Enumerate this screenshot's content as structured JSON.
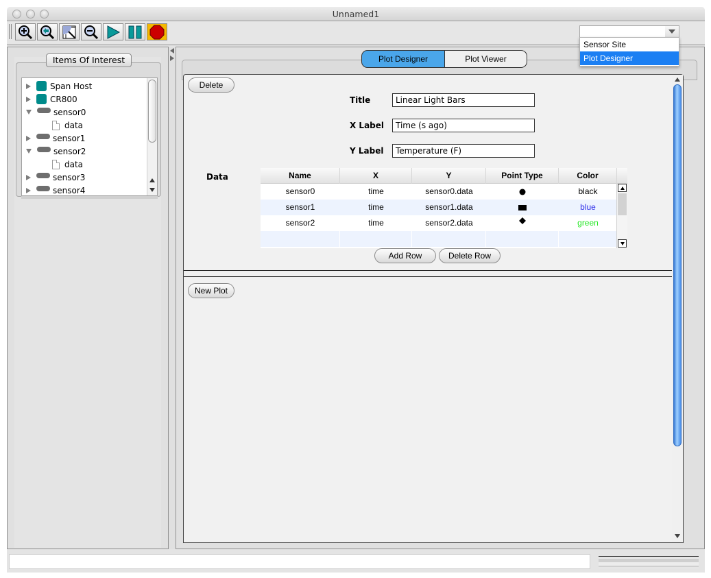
{
  "window": {
    "title": "Unnamed1"
  },
  "toolbar": {
    "buttons": [
      {
        "icon": "zoom-in-icon",
        "label": "Zoom In"
      },
      {
        "icon": "zoom-back-icon",
        "label": "Zoom Back"
      },
      {
        "icon": "zoom-fit-icon",
        "label": "Zoom To Fit"
      },
      {
        "icon": "zoom-out-icon",
        "label": "Zoom Out"
      },
      {
        "icon": "play-icon",
        "label": "Play"
      },
      {
        "icon": "pause-icon",
        "label": "Pause"
      },
      {
        "icon": "stop-icon",
        "label": "Stop",
        "active": true
      }
    ],
    "view_combo": {
      "value": "",
      "options": [
        "Sensor Site",
        "Plot Designer"
      ],
      "highlighted": "Plot Designer"
    }
  },
  "left_panel": {
    "group_title": "Items Of Interest",
    "tree": [
      {
        "label": "Span Host",
        "type": "host",
        "expanded": false,
        "depth": 0
      },
      {
        "label": "CR800",
        "type": "host",
        "expanded": false,
        "depth": 0
      },
      {
        "label": "sensor0",
        "type": "sensor",
        "expanded": true,
        "depth": 0
      },
      {
        "label": "data",
        "type": "data",
        "depth": 1
      },
      {
        "label": "sensor1",
        "type": "sensor",
        "expanded": false,
        "depth": 0
      },
      {
        "label": "sensor2",
        "type": "sensor",
        "expanded": true,
        "depth": 0
      },
      {
        "label": "data",
        "type": "data",
        "depth": 1
      },
      {
        "label": "sensor3",
        "type": "sensor",
        "expanded": false,
        "depth": 0
      },
      {
        "label": "sensor4",
        "type": "sensor",
        "expanded": false,
        "depth": 0
      }
    ]
  },
  "tabs": [
    {
      "label": "Plot Designer",
      "active": true
    },
    {
      "label": "Plot Viewer",
      "active": false
    }
  ],
  "plot_designer": {
    "delete_label": "Delete",
    "fields": {
      "title_label": "Title",
      "title_value": "Linear Light Bars",
      "xlabel_label": "X Label",
      "xlabel_value": "Time (s ago)",
      "ylabel_label": "Y Label",
      "ylabel_value": "Temperature (F)"
    },
    "data_label": "Data",
    "table": {
      "columns": [
        "Name",
        "X",
        "Y",
        "Point Type",
        "Color"
      ],
      "rows": [
        {
          "name": "sensor0",
          "x": "time",
          "y": "sensor0.data",
          "point_type": "circle",
          "color": "black",
          "color_hex": "#000000"
        },
        {
          "name": "sensor1",
          "x": "time",
          "y": "sensor1.data",
          "point_type": "square",
          "color": "blue",
          "color_hex": "#2a2ae8"
        },
        {
          "name": "sensor2",
          "x": "time",
          "y": "sensor2.data",
          "point_type": "diamond",
          "color": "green",
          "color_hex": "#22e622"
        }
      ]
    },
    "add_row_label": "Add Row",
    "delete_row_label": "Delete Row",
    "new_plot_label": "New Plot"
  },
  "colors": {
    "active_tab": "#4aa6ea",
    "selection": "#1b7ff3",
    "host_icon": "#008b8b",
    "stop_active_bg": "#f5b800"
  }
}
